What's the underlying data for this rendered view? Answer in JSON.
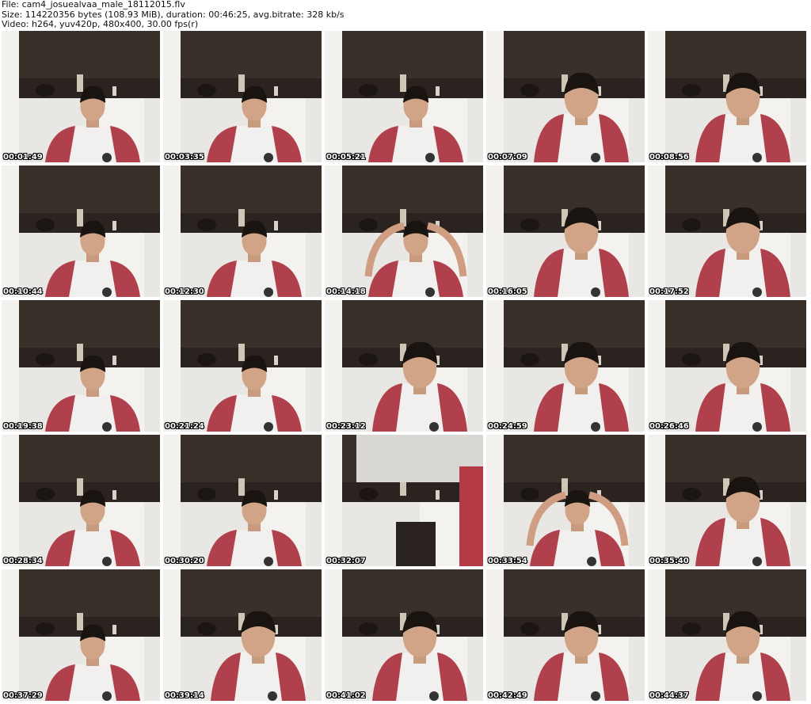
{
  "header": {
    "line1": "File: cam4_josuealvaa_male_18112015.flv",
    "line2": "Size: 114220356 bytes (108.93 MiB), duration: 00:46:25, avg.bitrate: 328 kb/s",
    "line3": "Video: h264, yuv420p, 480x400, 30.00 fps(r)"
  },
  "thumbnails": [
    {
      "timestamp": "00:01:49",
      "variant": "normal"
    },
    {
      "timestamp": "00:03:35",
      "variant": "normal"
    },
    {
      "timestamp": "00:05:21",
      "variant": "normal"
    },
    {
      "timestamp": "00:07:09",
      "variant": "close"
    },
    {
      "timestamp": "00:08:56",
      "variant": "close"
    },
    {
      "timestamp": "00:10:44",
      "variant": "normal"
    },
    {
      "timestamp": "00:12:30",
      "variant": "normal"
    },
    {
      "timestamp": "00:14:18",
      "variant": "arms"
    },
    {
      "timestamp": "00:16:05",
      "variant": "close"
    },
    {
      "timestamp": "00:17:52",
      "variant": "close"
    },
    {
      "timestamp": "00:19:38",
      "variant": "normal"
    },
    {
      "timestamp": "00:21:24",
      "variant": "normal"
    },
    {
      "timestamp": "00:23:12",
      "variant": "close"
    },
    {
      "timestamp": "00:24:59",
      "variant": "close"
    },
    {
      "timestamp": "00:26:46",
      "variant": "close"
    },
    {
      "timestamp": "00:28:34",
      "variant": "normal"
    },
    {
      "timestamp": "00:30:20",
      "variant": "normal"
    },
    {
      "timestamp": "00:32:07",
      "variant": "empty"
    },
    {
      "timestamp": "00:33:54",
      "variant": "arms"
    },
    {
      "timestamp": "00:35:40",
      "variant": "close"
    },
    {
      "timestamp": "00:37:29",
      "variant": "normal"
    },
    {
      "timestamp": "00:39:14",
      "variant": "close"
    },
    {
      "timestamp": "00:41:02",
      "variant": "close"
    },
    {
      "timestamp": "00:42:49",
      "variant": "close"
    },
    {
      "timestamp": "00:44:37",
      "variant": "close"
    }
  ]
}
